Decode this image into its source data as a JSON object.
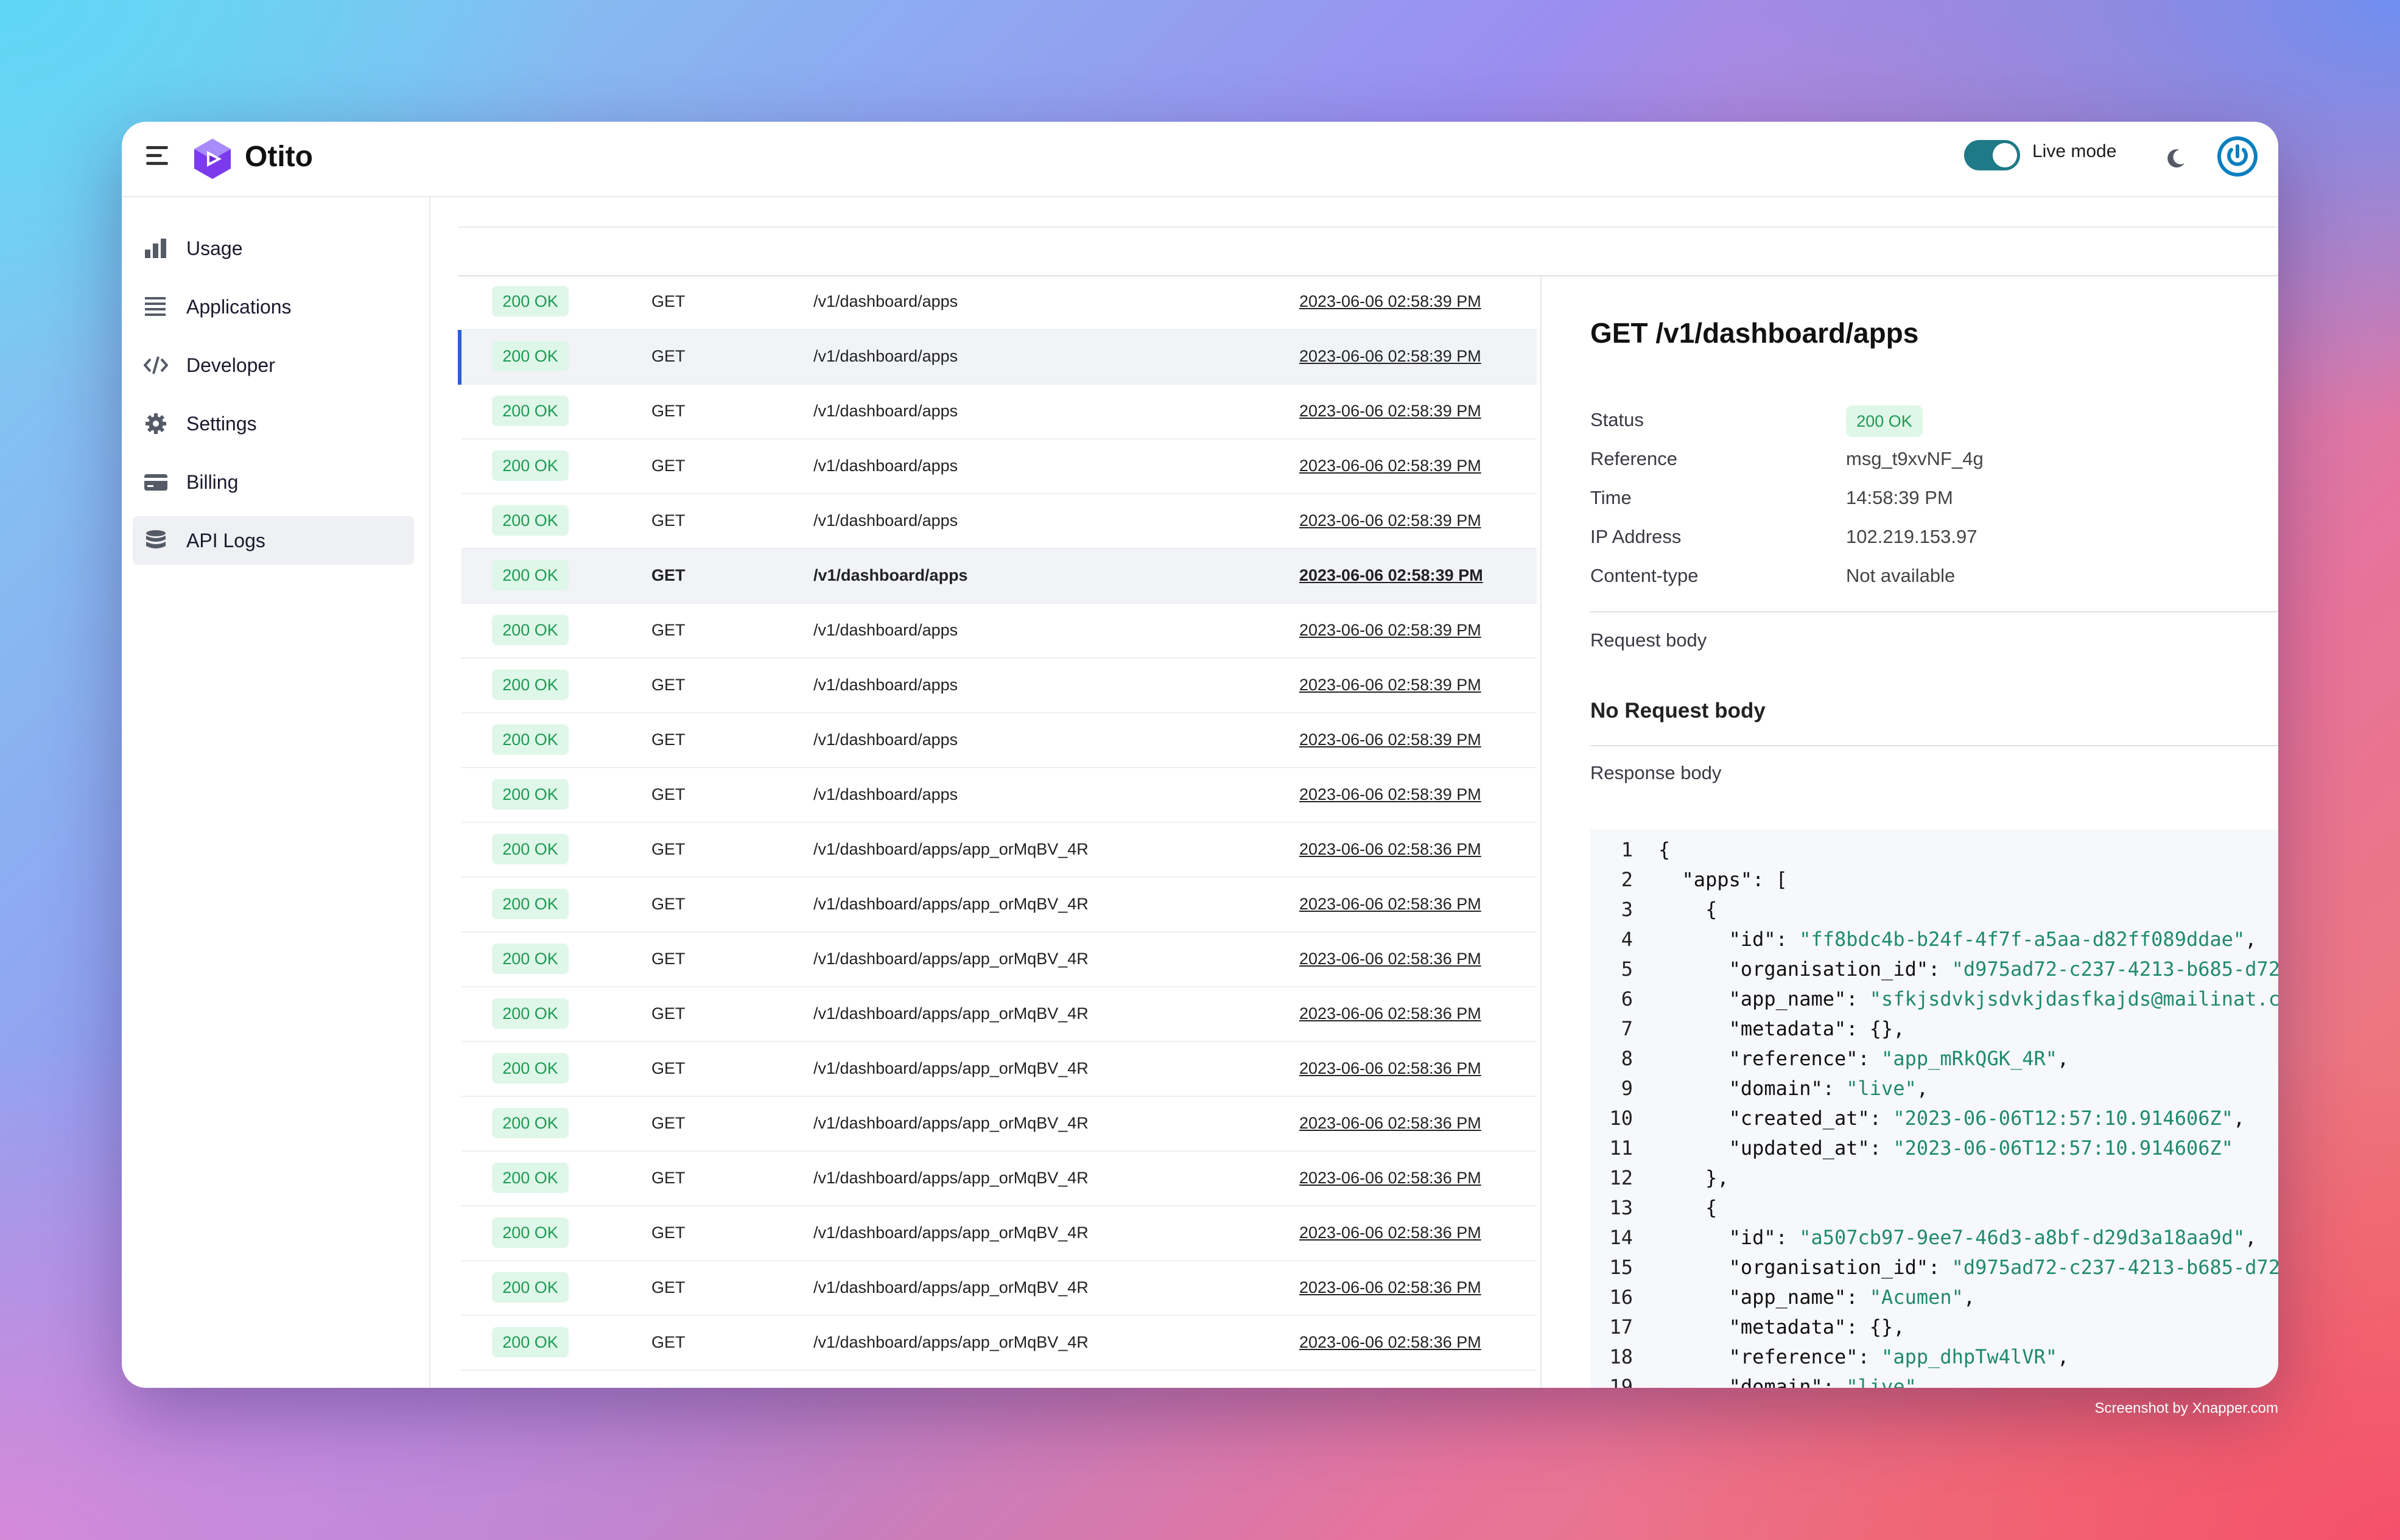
{
  "app": {
    "brand": "Otito",
    "live_mode_label": "Live mode",
    "live_mode_on": true
  },
  "sidebar": {
    "items": [
      {
        "label": "Usage",
        "icon": "bar-chart-icon",
        "active": false
      },
      {
        "label": "Applications",
        "icon": "list-icon",
        "active": false
      },
      {
        "label": "Developer",
        "icon": "code-icon",
        "active": false
      },
      {
        "label": "Settings",
        "icon": "gear-icon",
        "active": false
      },
      {
        "label": "Billing",
        "icon": "credit-card-icon",
        "active": false
      },
      {
        "label": "API Logs",
        "icon": "database-icon",
        "active": true
      }
    ]
  },
  "logs": [
    {
      "status": "200 OK",
      "method": "GET",
      "path": "/v1/dashboard/apps",
      "time": "2023-06-06 02:58:39 PM"
    },
    {
      "status": "200 OK",
      "method": "GET",
      "path": "/v1/dashboard/apps",
      "time": "2023-06-06 02:58:39 PM"
    },
    {
      "status": "200 OK",
      "method": "GET",
      "path": "/v1/dashboard/apps",
      "time": "2023-06-06 02:58:39 PM"
    },
    {
      "status": "200 OK",
      "method": "GET",
      "path": "/v1/dashboard/apps",
      "time": "2023-06-06 02:58:39 PM"
    },
    {
      "status": "200 OK",
      "method": "GET",
      "path": "/v1/dashboard/apps",
      "time": "2023-06-06 02:58:39 PM"
    },
    {
      "status": "200 OK",
      "method": "GET",
      "path": "/v1/dashboard/apps",
      "time": "2023-06-06 02:58:39 PM"
    },
    {
      "status": "200 OK",
      "method": "GET",
      "path": "/v1/dashboard/apps",
      "time": "2023-06-06 02:58:39 PM"
    },
    {
      "status": "200 OK",
      "method": "GET",
      "path": "/v1/dashboard/apps",
      "time": "2023-06-06 02:58:39 PM"
    },
    {
      "status": "200 OK",
      "method": "GET",
      "path": "/v1/dashboard/apps",
      "time": "2023-06-06 02:58:39 PM"
    },
    {
      "status": "200 OK",
      "method": "GET",
      "path": "/v1/dashboard/apps",
      "time": "2023-06-06 02:58:39 PM"
    },
    {
      "status": "200 OK",
      "method": "GET",
      "path": "/v1/dashboard/apps/app_orMqBV_4R",
      "time": "2023-06-06 02:58:36 PM"
    },
    {
      "status": "200 OK",
      "method": "GET",
      "path": "/v1/dashboard/apps/app_orMqBV_4R",
      "time": "2023-06-06 02:58:36 PM"
    },
    {
      "status": "200 OK",
      "method": "GET",
      "path": "/v1/dashboard/apps/app_orMqBV_4R",
      "time": "2023-06-06 02:58:36 PM"
    },
    {
      "status": "200 OK",
      "method": "GET",
      "path": "/v1/dashboard/apps/app_orMqBV_4R",
      "time": "2023-06-06 02:58:36 PM"
    },
    {
      "status": "200 OK",
      "method": "GET",
      "path": "/v1/dashboard/apps/app_orMqBV_4R",
      "time": "2023-06-06 02:58:36 PM"
    },
    {
      "status": "200 OK",
      "method": "GET",
      "path": "/v1/dashboard/apps/app_orMqBV_4R",
      "time": "2023-06-06 02:58:36 PM"
    },
    {
      "status": "200 OK",
      "method": "GET",
      "path": "/v1/dashboard/apps/app_orMqBV_4R",
      "time": "2023-06-06 02:58:36 PM"
    },
    {
      "status": "200 OK",
      "method": "GET",
      "path": "/v1/dashboard/apps/app_orMqBV_4R",
      "time": "2023-06-06 02:58:36 PM"
    },
    {
      "status": "200 OK",
      "method": "GET",
      "path": "/v1/dashboard/apps/app_orMqBV_4R",
      "time": "2023-06-06 02:58:36 PM"
    },
    {
      "status": "200 OK",
      "method": "GET",
      "path": "/v1/dashboard/apps/app_orMqBV_4R",
      "time": "2023-06-06 02:58:36 PM"
    }
  ],
  "detail": {
    "title": "GET /v1/dashboard/apps",
    "fields": [
      {
        "label": "Status",
        "value": "200 OK"
      },
      {
        "label": "Reference",
        "value": "msg_t9xvNF_4g"
      },
      {
        "label": "Time",
        "value": "14:58:39 PM"
      },
      {
        "label": "IP Address",
        "value": "102.219.153.97"
      },
      {
        "label": "Content-type",
        "value": "Not available"
      }
    ],
    "request_body_label": "Request body",
    "no_request_body": "No Request body",
    "response_body_label": "Response body",
    "code_lines": [
      "{",
      "  \"apps\": [",
      "    {",
      "      \"id\": \"ff8bdc4b-b24f-4f7f-a5aa-d82ff089ddae\",",
      "      \"organisation_id\": \"d975ad72-c237-4213-b685-d72",
      "      \"app_name\": \"sfkjsdvkjsdvkjdasfkajds@mailinat.c",
      "      \"metadata\": {},",
      "      \"reference\": \"app_mRkQGK_4R\",",
      "      \"domain\": \"live\",",
      "      \"created_at\": \"2023-06-06T12:57:10.914606Z\",",
      "      \"updated_at\": \"2023-06-06T12:57:10.914606Z\"",
      "    },",
      "    {",
      "      \"id\": \"a507cb97-9ee7-46d3-a8bf-d29d3a18aa9d\",",
      "      \"organisation_id\": \"d975ad72-c237-4213-b685-d72",
      "      \"app_name\": \"Acumen\",",
      "      \"metadata\": {},",
      "      \"reference\": \"app_dhpTw4lVR\",",
      "      \"domain\": \"live\""
    ]
  },
  "watermark": "Screenshot by Xnapper.com"
}
